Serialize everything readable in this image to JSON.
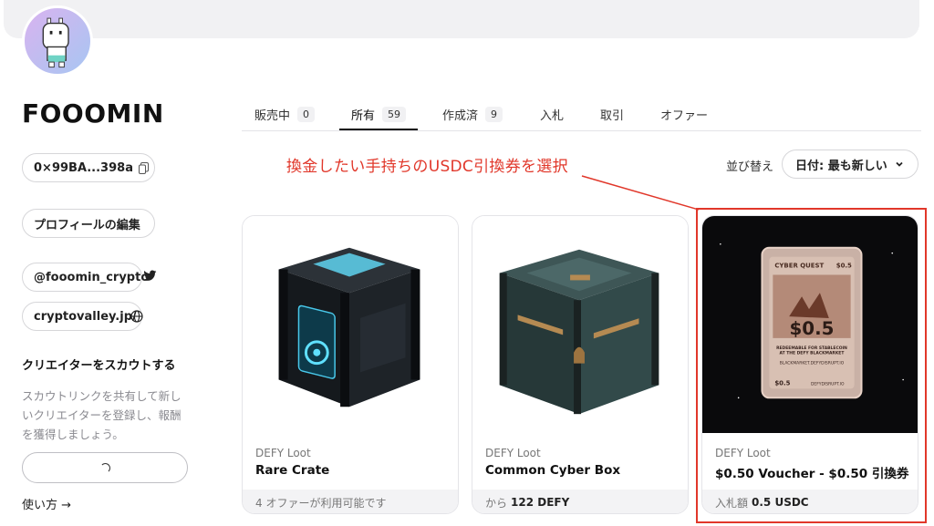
{
  "profile": {
    "username": "FOOOMIN",
    "address": "0×99BA...398a",
    "edit_profile": "プロフィールの編集",
    "twitter": "@fooomin_crypto",
    "website": "cryptovalley.jp/",
    "scout_title": "クリエイターをスカウトする",
    "scout_desc": "スカウトリンクを共有して新しいクリエイターを登録し、報酬を獲得しましょう。",
    "howto": "使い方 →"
  },
  "tabs": [
    {
      "label": "販売中",
      "count": "0"
    },
    {
      "label": "所有",
      "count": "59"
    },
    {
      "label": "作成済",
      "count": "9"
    },
    {
      "label": "入札"
    },
    {
      "label": "取引"
    },
    {
      "label": "オファー"
    }
  ],
  "active_tab": "所有",
  "annotation": "換金したい手持ちのUSDC引換券を選択",
  "sort": {
    "label": "並び替え",
    "selected": "日付: 最も新しい"
  },
  "items": [
    {
      "collection": "DEFY Loot",
      "name": "Rare Crate",
      "footer_prefix": "",
      "footer_value": "4 オファーが利用可能です",
      "footer_strong": ""
    },
    {
      "collection": "DEFY Loot",
      "name": "Common Cyber Box",
      "footer_prefix": "から",
      "footer_strong": "122 DEFY"
    },
    {
      "collection": "DEFY Loot",
      "name": "$0.50 Voucher - $0.50 引換券",
      "footer_prefix": "入札額",
      "footer_strong": "0.5 USDC"
    }
  ],
  "voucher_art": {
    "brand": "CYBER QUEST",
    "value": "$0.5",
    "corner": "$0.5",
    "line1": "REDEEMABLE FOR STABLECOIN",
    "line2": "AT THE DEFY BLACKMARKET",
    "site": "BLACKMARKET.DEFYDISRUPT.IO",
    "bottom_left": "$0.5",
    "bottom_right": "DEFYDISRUPT.IO"
  },
  "colors": {
    "annotation": "#e1372a",
    "avatar_from": "#d9b3ef",
    "avatar_to": "#a7c6f2"
  }
}
